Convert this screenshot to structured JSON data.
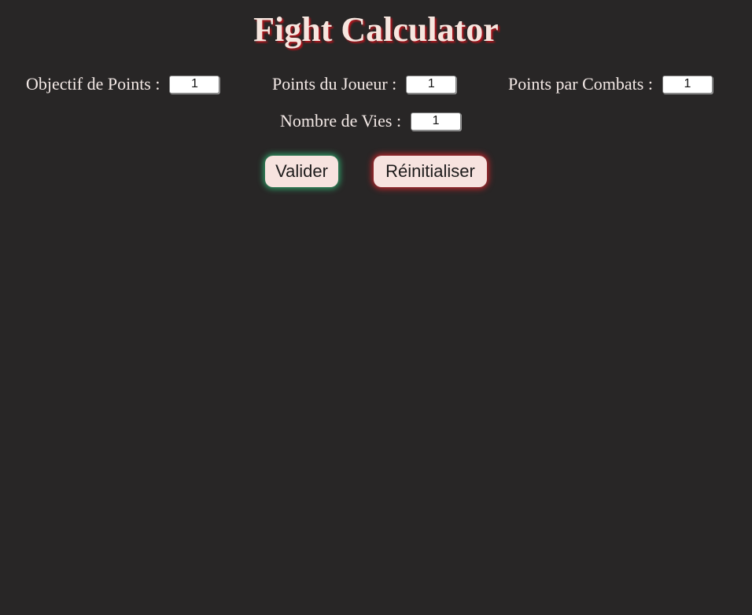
{
  "page": {
    "title": "Fight Calculator"
  },
  "form": {
    "objectif_label": "Objectif de Points :",
    "objectif_value": "1",
    "joueur_label": "Points du Joueur :",
    "joueur_value": "1",
    "combats_label": "Points par Combats :",
    "combats_value": "1",
    "vies_label": "Nombre de Vies :",
    "vies_value": "1"
  },
  "buttons": {
    "validate_label": "Valider",
    "reset_label": "Réinitialiser"
  },
  "colors": {
    "background": "#282626",
    "title_shadow": "#b8141c",
    "validate_glow": "#2fa36a",
    "reset_glow": "#c4262c",
    "button_bg": "#f7e3df"
  }
}
